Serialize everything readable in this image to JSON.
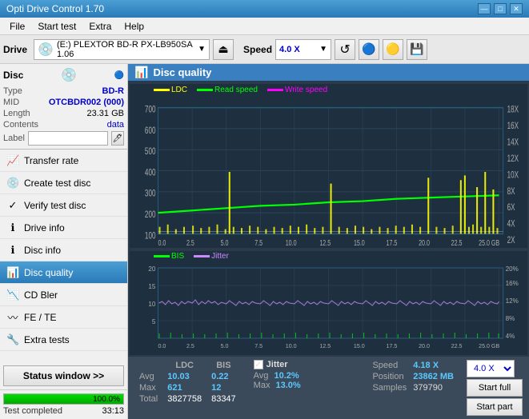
{
  "app": {
    "title": "Opti Drive Control 1.70",
    "icon": "💿"
  },
  "titlebar": {
    "minimize": "—",
    "maximize": "□",
    "close": "✕"
  },
  "menu": {
    "items": [
      "File",
      "Start test",
      "Extra",
      "Help"
    ]
  },
  "toolbar": {
    "drive_label": "Drive",
    "drive_value": "(E:) PLEXTOR BD-R  PX-LB950SA 1.06",
    "eject_icon": "⏏",
    "speed_label": "Speed",
    "speed_value": "4.0 X"
  },
  "disc": {
    "title": "Disc",
    "type_label": "Type",
    "type_value": "BD-R",
    "mid_label": "MID",
    "mid_value": "OTCBDR002 (000)",
    "length_label": "Length",
    "length_value": "23.31 GB",
    "contents_label": "Contents",
    "contents_value": "data",
    "label_label": "Label",
    "label_value": ""
  },
  "sidebar": {
    "items": [
      {
        "label": "Transfer rate",
        "icon": "📈",
        "active": false
      },
      {
        "label": "Create test disc",
        "icon": "💿",
        "active": false
      },
      {
        "label": "Verify test disc",
        "icon": "✓",
        "active": false
      },
      {
        "label": "Drive info",
        "icon": "ℹ",
        "active": false
      },
      {
        "label": "Disc info",
        "icon": "ℹ",
        "active": false
      },
      {
        "label": "Disc quality",
        "icon": "📊",
        "active": true
      },
      {
        "label": "CD Bler",
        "icon": "📉",
        "active": false
      },
      {
        "label": "FE / TE",
        "icon": "〰",
        "active": false
      },
      {
        "label": "Extra tests",
        "icon": "🔧",
        "active": false
      }
    ],
    "status_btn": "Status window >>"
  },
  "progress": {
    "percent": 100,
    "status": "Test completed",
    "time": "33:13"
  },
  "chart": {
    "title": "Disc quality",
    "legend_top": [
      {
        "label": "LDC",
        "color": "#ffff00"
      },
      {
        "label": "Read speed",
        "color": "#00ff00"
      },
      {
        "label": "Write speed",
        "color": "#ff00ff"
      }
    ],
    "legend_bottom": [
      {
        "label": "BIS",
        "color": "#00ff00"
      },
      {
        "label": "Jitter",
        "color": "#cc88ff"
      }
    ],
    "top_y_left": [
      "700",
      "600",
      "500",
      "400",
      "300",
      "200",
      "100"
    ],
    "top_y_right": [
      "18X",
      "16X",
      "14X",
      "12X",
      "10X",
      "8X",
      "6X",
      "4X",
      "2X"
    ],
    "top_x": [
      "0.0",
      "2.5",
      "5.0",
      "7.5",
      "10.0",
      "12.5",
      "15.0",
      "17.5",
      "20.0",
      "22.5",
      "25.0 GB"
    ],
    "bottom_y_left": [
      "20",
      "15",
      "10",
      "5"
    ],
    "bottom_y_right": [
      "20%",
      "16%",
      "12%",
      "8%",
      "4%"
    ],
    "bottom_x": [
      "0.0",
      "2.5",
      "5.0",
      "7.5",
      "10.0",
      "12.5",
      "15.0",
      "17.5",
      "20.0",
      "22.5",
      "25.0 GB"
    ]
  },
  "stats": {
    "headers": [
      "LDC",
      "BIS"
    ],
    "rows": [
      {
        "label": "Avg",
        "ldc": "10.03",
        "bis": "0.22"
      },
      {
        "label": "Max",
        "ldc": "621",
        "bis": "12"
      },
      {
        "label": "Total",
        "ldc": "3827758",
        "bis": "83347"
      }
    ],
    "jitter_label": "Jitter",
    "jitter_checked": true,
    "jitter_avg": "10.2%",
    "jitter_max": "13.0%",
    "speed_label": "Speed",
    "speed_val": "4.18 X",
    "position_label": "Position",
    "position_val": "23862 MB",
    "samples_label": "Samples",
    "samples_val": "379790",
    "speed_dropdown": "4.0 X",
    "btn_full": "Start full",
    "btn_part": "Start part"
  }
}
